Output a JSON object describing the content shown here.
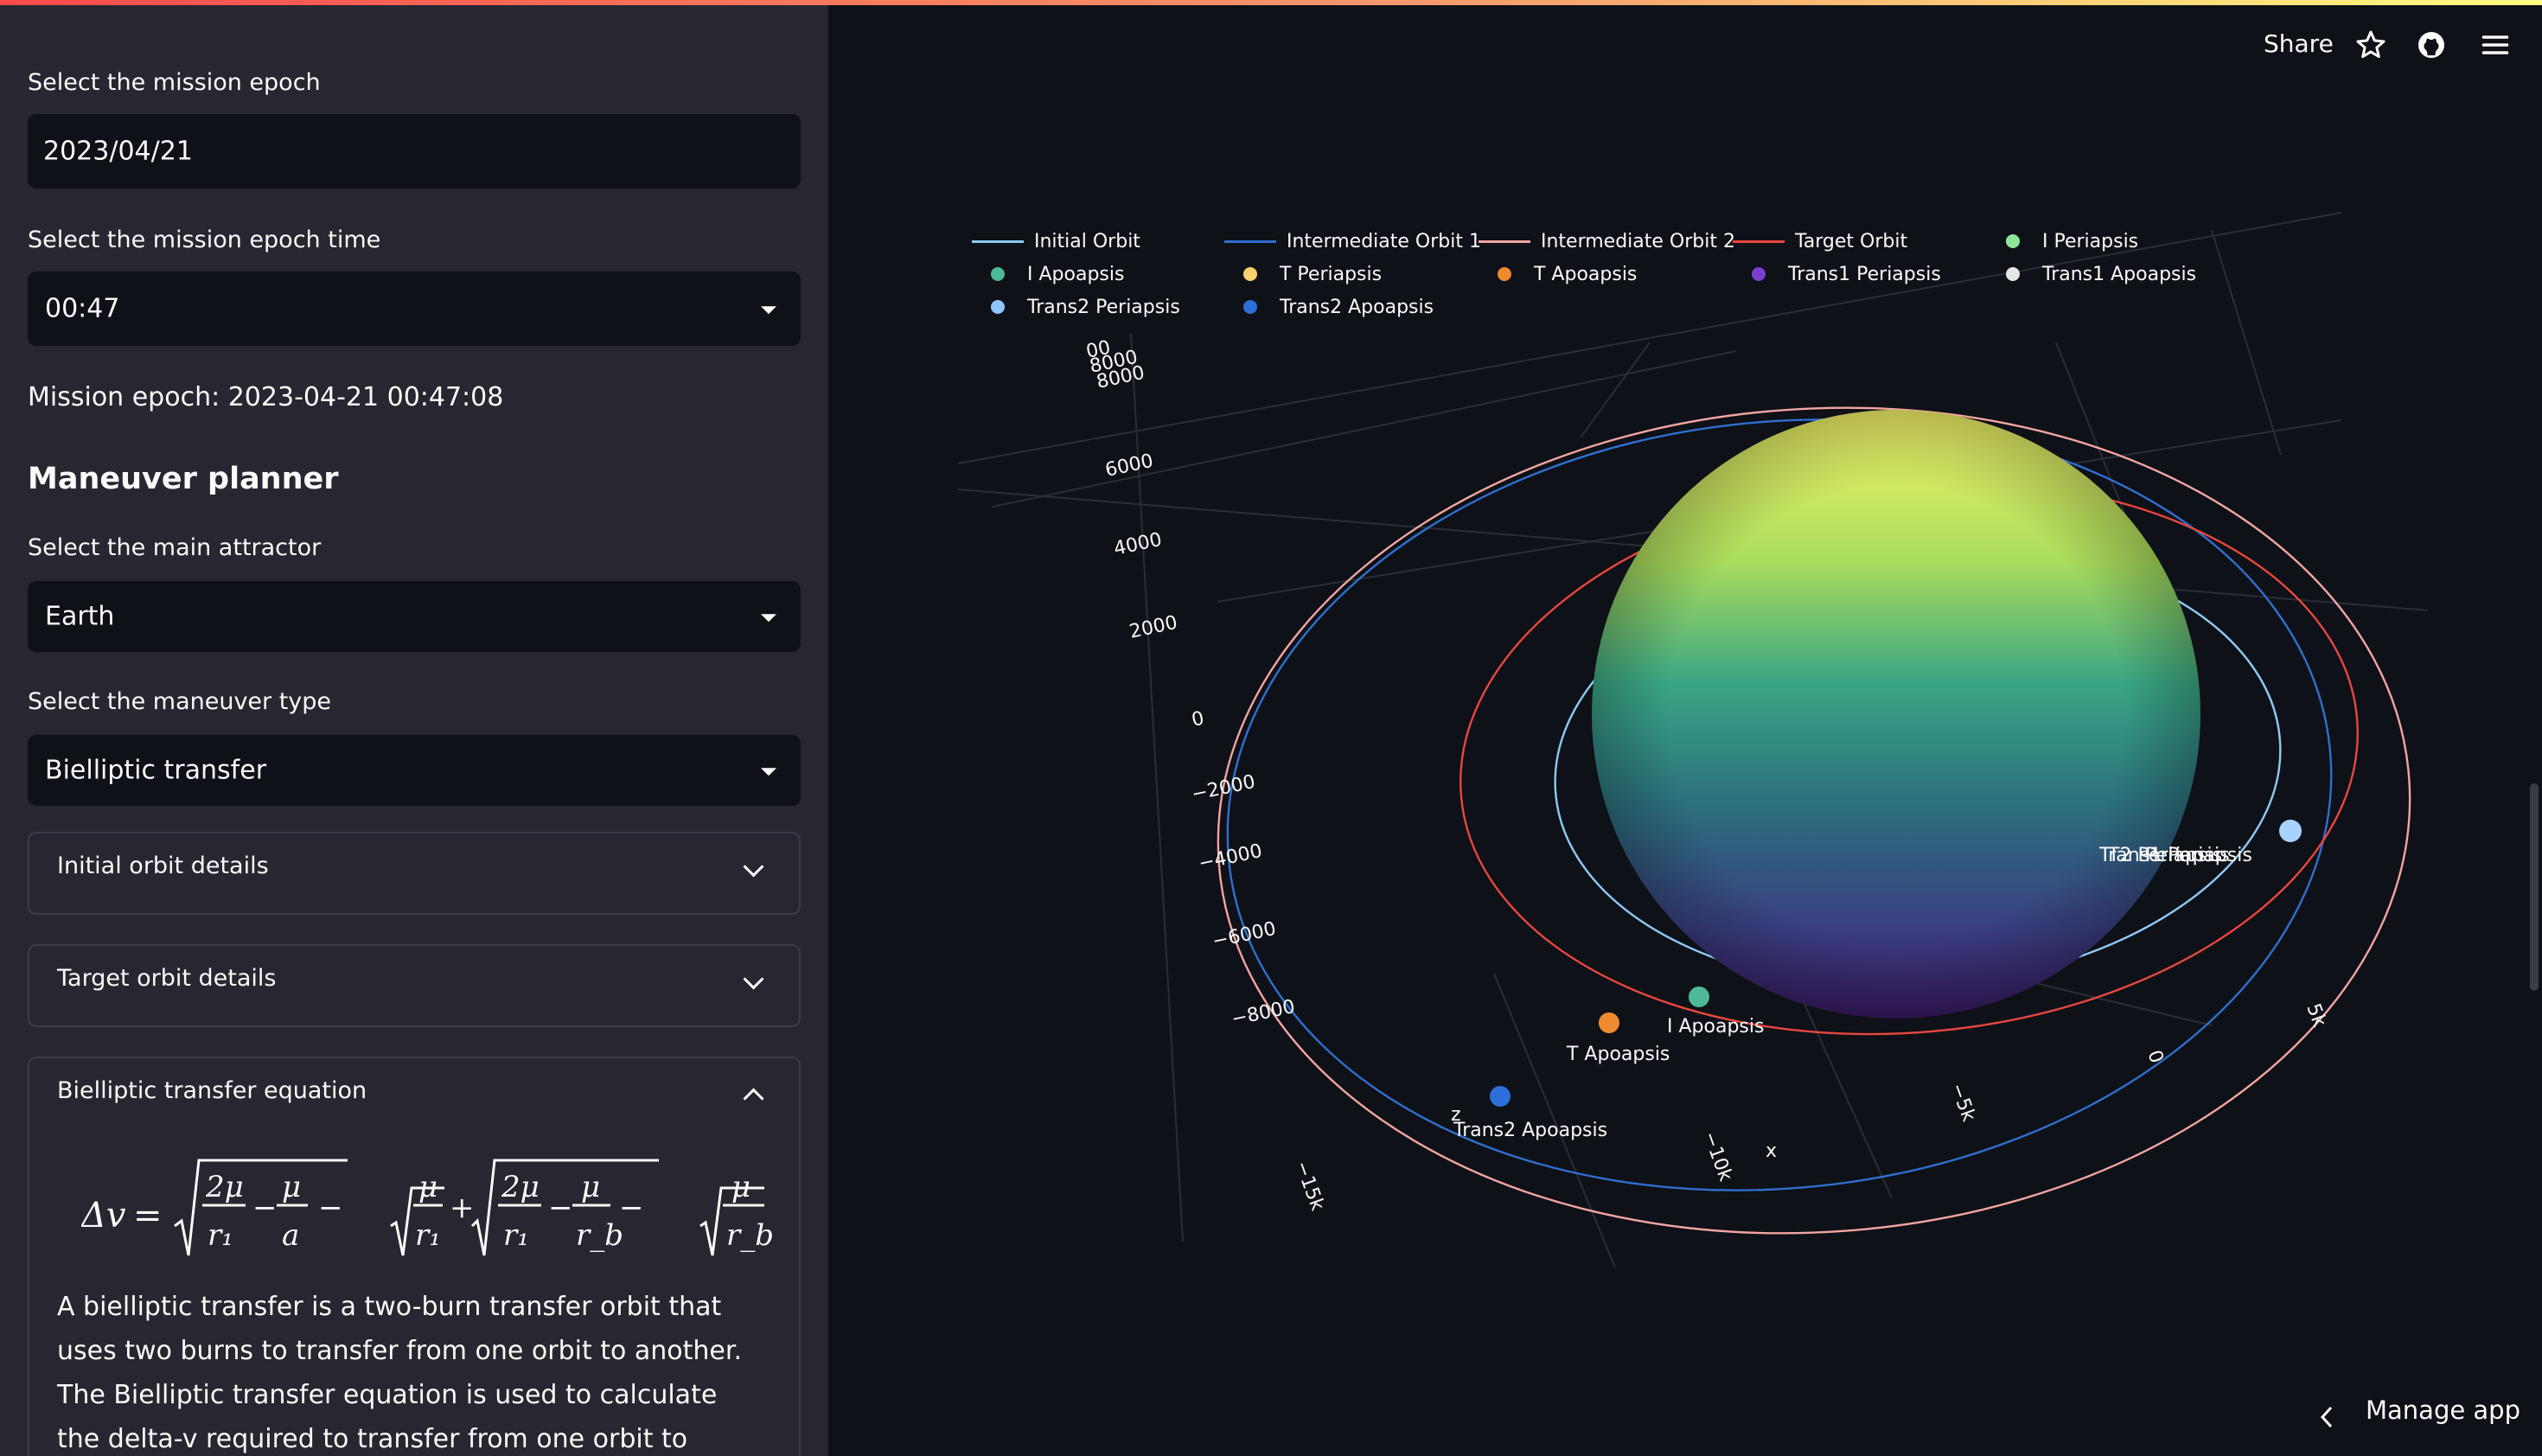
{
  "sidebar": {
    "epoch_label": "Select the mission epoch",
    "epoch_value": "2023/04/21",
    "time_label": "Select the mission epoch time",
    "time_value": "00:47",
    "mission_epoch": "Mission epoch: 2023-04-21 00:47:08",
    "planner_heading": "Maneuver planner",
    "attractor_label": "Select the main attractor",
    "attractor_value": "Earth",
    "maneuver_label": "Select the maneuver type",
    "maneuver_value": "Bielliptic transfer",
    "expanders": [
      {
        "title": "Initial orbit details",
        "expanded": false
      },
      {
        "title": "Target orbit details",
        "expanded": false
      },
      {
        "title": "Bielliptic transfer equation",
        "expanded": true
      }
    ],
    "equation": "Δv = √(2μ/r₁ − μ/a) − √(μ/r₁) + √(2μ/r₁ − μ/r_b) − √(μ/r_b)",
    "description": "A bielliptic transfer is a two-burn transfer orbit that uses two burns to transfer from one orbit to another. The Bielliptic transfer equation is used to calculate the delta-v required to transfer from one orbit to another. The equation is given by:"
  },
  "header": {
    "share_label": "Share",
    "icons": [
      "star-icon",
      "github-icon",
      "menu-icon"
    ]
  },
  "footer": {
    "manage_label": "Manage app"
  },
  "plot": {
    "legend": [
      {
        "label": "Initial Orbit",
        "kind": "line",
        "color": "#8ec9f5"
      },
      {
        "label": "Intermediate Orbit 1",
        "kind": "line",
        "color": "#2f6fd0"
      },
      {
        "label": "Intermediate Orbit 2",
        "kind": "line",
        "color": "#f2a5a0"
      },
      {
        "label": "Target Orbit",
        "kind": "line",
        "color": "#e8473f"
      },
      {
        "label": "I Periapsis",
        "kind": "marker",
        "color": "#8ee69a"
      },
      {
        "label": "I Apoapsis",
        "kind": "marker",
        "color": "#4db89a"
      },
      {
        "label": "T Periapsis",
        "kind": "marker",
        "color": "#f7d26e"
      },
      {
        "label": "T Apoapsis",
        "kind": "marker",
        "color": "#f08a2e"
      },
      {
        "label": "Trans1 Periapsis",
        "kind": "marker",
        "color": "#7a3fd0"
      },
      {
        "label": "Trans1 Apoapsis",
        "kind": "marker",
        "color": "#e6e6e6"
      },
      {
        "label": "Trans2 Periapsis",
        "kind": "marker",
        "color": "#8ec5ff"
      },
      {
        "label": "Trans2 Apoapsis",
        "kind": "marker",
        "color": "#2d6fd8"
      }
    ],
    "z_ticks": [
      "00",
      "8000",
      "8000",
      "6000",
      "4000",
      "2000",
      "0",
      "−2000",
      "−4000",
      "−6000",
      "−8000"
    ],
    "x_ticks": [
      "−15k",
      "−10k",
      "−5k",
      "0",
      "5k"
    ],
    "axis_labels": {
      "z": "z",
      "x": "x"
    },
    "point_labels": [
      {
        "text": "I Apoapsis"
      },
      {
        "text": "T Apoapsis"
      },
      {
        "text": "Trans2 Apoapsis"
      },
      {
        "text": "Trans1 Periapsis"
      },
      {
        "text": "T2 Periapsis"
      },
      {
        "text": "Periapsis"
      }
    ]
  }
}
